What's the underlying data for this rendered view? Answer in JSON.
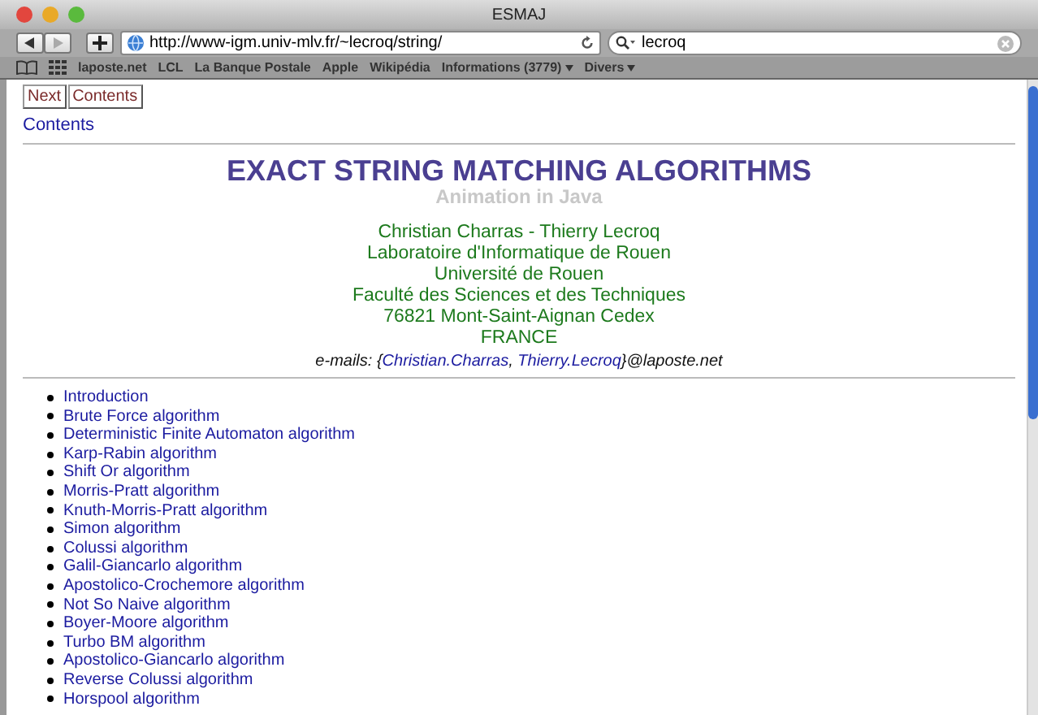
{
  "window": {
    "title": "ESMAJ"
  },
  "toolbar": {
    "url": "http://www-igm.univ-mlv.fr/~lecroq/string/",
    "search": "lecroq",
    "back_disabled": false,
    "forward_disabled": true
  },
  "bookmarks": [
    {
      "label": "laposte.net",
      "menu": false
    },
    {
      "label": "LCL",
      "menu": false
    },
    {
      "label": "La Banque Postale",
      "menu": false
    },
    {
      "label": "Apple",
      "menu": false
    },
    {
      "label": "Wikipédia",
      "menu": false
    },
    {
      "label": "Informations (3779)",
      "menu": true
    },
    {
      "label": "Divers",
      "menu": true
    }
  ],
  "nav_buttons": [
    "Next",
    "Contents"
  ],
  "contents_link": "Contents",
  "title": "EXACT STRING MATCHING ALGORITHMS",
  "subtitle": "Animation in Java",
  "address_lines": [
    "Christian Charras - Thierry Lecroq",
    "Laboratoire d'Informatique de Rouen",
    "Université de Rouen",
    "Faculté des Sciences et des Techniques",
    "76821 Mont-Saint-Aignan Cedex",
    "FRANCE"
  ],
  "emails": {
    "prefix": "e-mails: {",
    "links": [
      "Christian.Charras",
      "Thierry.Lecroq"
    ],
    "separator": ", ",
    "suffix": "}@laposte.net"
  },
  "algorithms": [
    "Introduction",
    "Brute Force algorithm",
    "Deterministic Finite Automaton algorithm",
    "Karp-Rabin algorithm",
    "Shift Or algorithm",
    "Morris-Pratt algorithm",
    "Knuth-Morris-Pratt algorithm",
    "Simon algorithm",
    "Colussi algorithm",
    "Galil-Giancarlo algorithm",
    "Apostolico-Crochemore algorithm",
    "Not So Naive algorithm",
    "Boyer-Moore algorithm",
    "Turbo BM algorithm",
    "Apostolico-Giancarlo algorithm",
    "Reverse Colussi algorithm",
    "Horspool algorithm"
  ]
}
